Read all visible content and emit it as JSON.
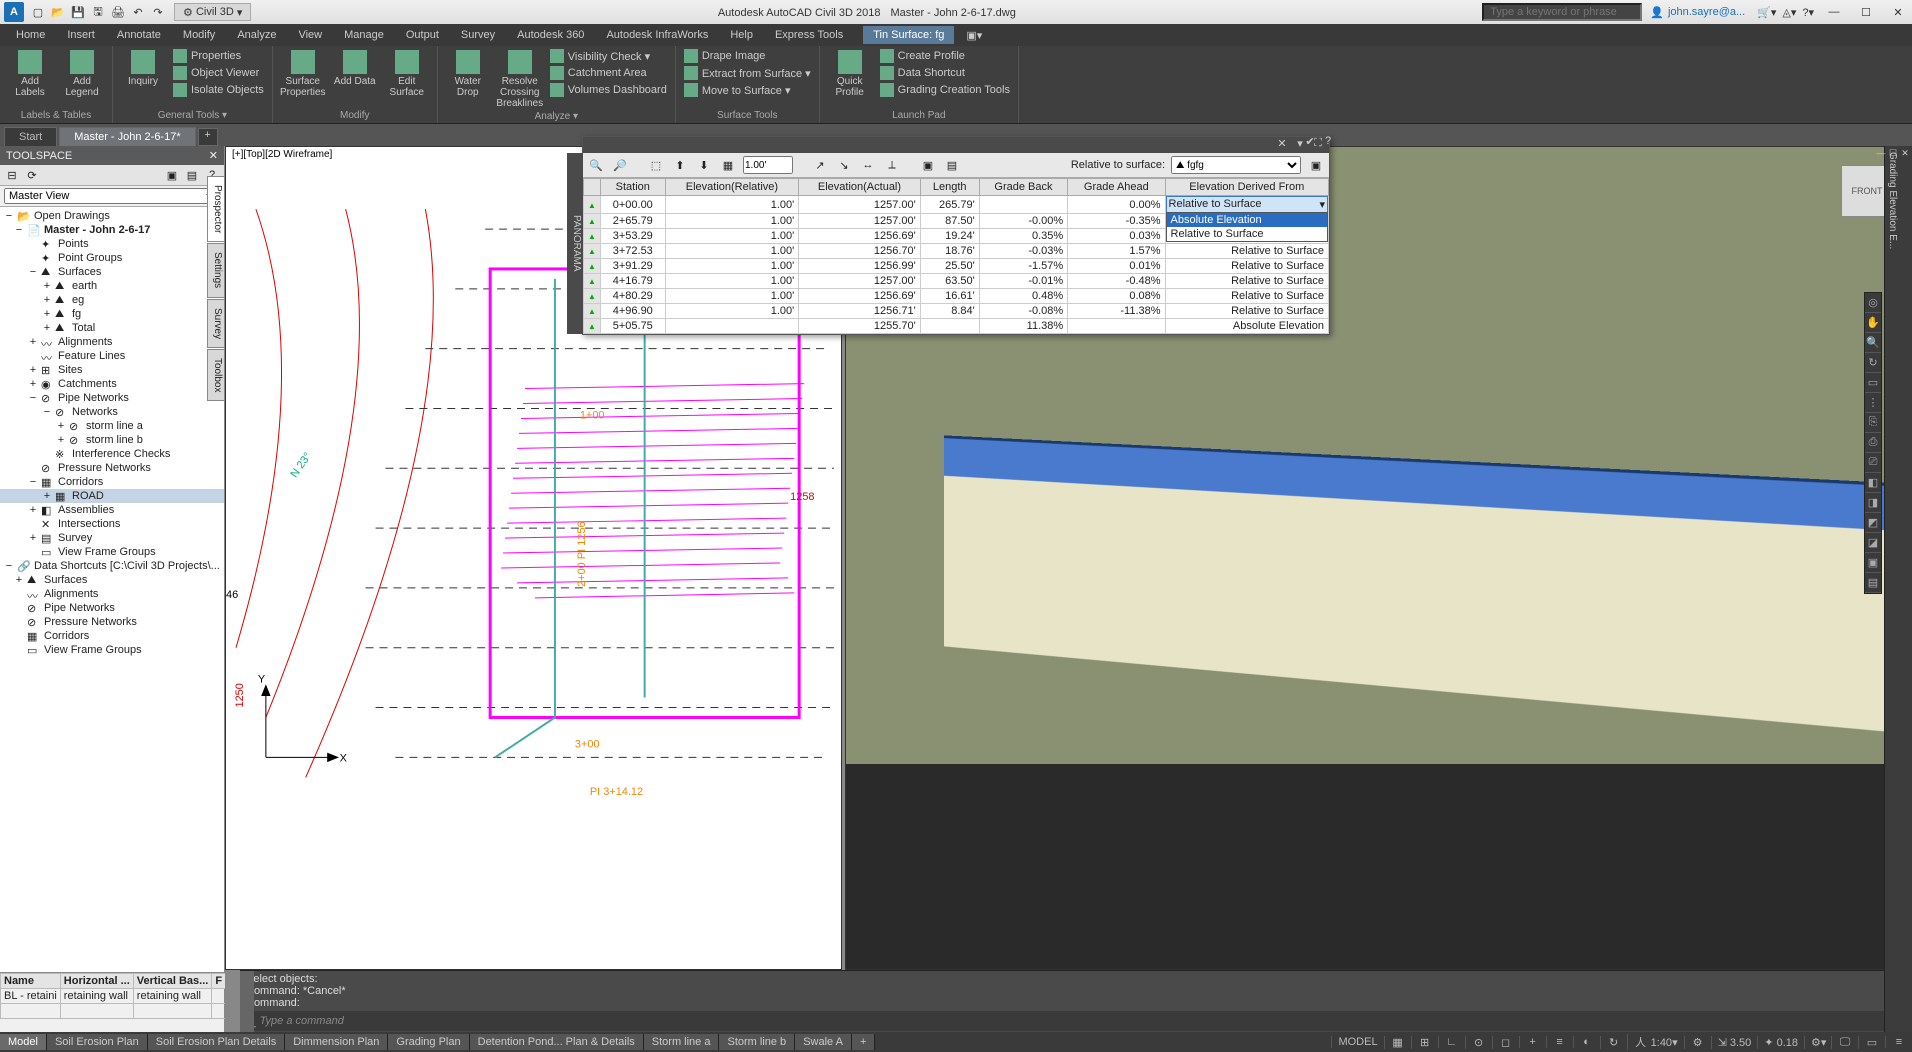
{
  "title": {
    "app": "Autodesk AutoCAD Civil 3D 2018",
    "doc": "Master - John 2-6-17.dwg",
    "workspace": "Civil 3D",
    "search_ph": "Type a keyword or phrase",
    "user": "john.sayre@a..."
  },
  "menu": {
    "tabs": [
      "Home",
      "Insert",
      "Annotate",
      "Modify",
      "Analyze",
      "View",
      "Manage",
      "Output",
      "Survey",
      "Autodesk 360",
      "Autodesk InfraWorks",
      "Help",
      "Express Tools",
      "Tin Surface: fg"
    ],
    "active_ctx": "Tin Surface: fg"
  },
  "ribbon": {
    "panels": [
      {
        "title": "Labels & Tables",
        "big": [
          {
            "lbl": "Add Labels"
          },
          {
            "lbl": "Add Legend"
          }
        ],
        "small": []
      },
      {
        "title": "General Tools ▾",
        "big": [
          {
            "lbl": "Inquiry"
          }
        ],
        "small": [
          "Properties",
          "Object Viewer",
          "Isolate Objects"
        ]
      },
      {
        "title": "Modify",
        "big": [
          {
            "lbl": "Surface Properties"
          },
          {
            "lbl": "Add Data"
          },
          {
            "lbl": "Edit Surface"
          }
        ],
        "small": []
      },
      {
        "title": "Analyze ▾",
        "big": [
          {
            "lbl": "Water Drop"
          },
          {
            "lbl": "Resolve Crossing Breaklines"
          }
        ],
        "small": [
          "Visibility Check ▾",
          "Catchment Area",
          "Volumes Dashboard"
        ]
      },
      {
        "title": "Surface Tools",
        "big": [],
        "small": [
          "Drape Image",
          "Extract from Surface ▾",
          "Move to Surface ▾"
        ]
      },
      {
        "title": "Launch Pad",
        "big": [
          {
            "lbl": "Quick Profile"
          }
        ],
        "small": [
          "Create Profile",
          "Data Shortcut",
          "Grading Creation Tools"
        ]
      }
    ]
  },
  "doctabs": {
    "tabs": [
      {
        "label": "Start"
      },
      {
        "label": "Master - John 2-6-17*",
        "active": true
      }
    ]
  },
  "toolspace": {
    "title": "TOOLSPACE",
    "view": "Master View",
    "tree": [
      {
        "d": 0,
        "tw": "−",
        "ico": "📂",
        "t": "Open Drawings"
      },
      {
        "d": 1,
        "tw": "−",
        "ico": "📄",
        "t": "Master - John 2-6-17",
        "b": true
      },
      {
        "d": 2,
        "tw": "",
        "ico": "✦",
        "t": "Points"
      },
      {
        "d": 2,
        "tw": "",
        "ico": "✦",
        "t": "Point Groups"
      },
      {
        "d": 2,
        "tw": "−",
        "ico": "⛰",
        "t": "Surfaces"
      },
      {
        "d": 3,
        "tw": "+",
        "ico": "⛰",
        "t": "earth"
      },
      {
        "d": 3,
        "tw": "+",
        "ico": "⛰",
        "t": "eg"
      },
      {
        "d": 3,
        "tw": "+",
        "ico": "⛰",
        "t": "fg"
      },
      {
        "d": 3,
        "tw": "+",
        "ico": "⛰",
        "t": "Total"
      },
      {
        "d": 2,
        "tw": "+",
        "ico": "〰",
        "t": "Alignments"
      },
      {
        "d": 2,
        "tw": "",
        "ico": "〰",
        "t": "Feature Lines"
      },
      {
        "d": 2,
        "tw": "+",
        "ico": "⊞",
        "t": "Sites"
      },
      {
        "d": 2,
        "tw": "+",
        "ico": "◉",
        "t": "Catchments"
      },
      {
        "d": 2,
        "tw": "−",
        "ico": "⊘",
        "t": "Pipe Networks"
      },
      {
        "d": 3,
        "tw": "−",
        "ico": "⊘",
        "t": "Networks"
      },
      {
        "d": 4,
        "tw": "+",
        "ico": "⊘",
        "t": "storm line a"
      },
      {
        "d": 4,
        "tw": "+",
        "ico": "⊘",
        "t": "storm line b"
      },
      {
        "d": 3,
        "tw": "",
        "ico": "※",
        "t": "Interference Checks"
      },
      {
        "d": 2,
        "tw": "",
        "ico": "⊘",
        "t": "Pressure Networks"
      },
      {
        "d": 2,
        "tw": "−",
        "ico": "▦",
        "t": "Corridors"
      },
      {
        "d": 3,
        "tw": "+",
        "ico": "▦",
        "t": "ROAD",
        "sel": true
      },
      {
        "d": 2,
        "tw": "+",
        "ico": "◧",
        "t": "Assemblies"
      },
      {
        "d": 2,
        "tw": "",
        "ico": "✕",
        "t": "Intersections"
      },
      {
        "d": 2,
        "tw": "+",
        "ico": "▤",
        "t": "Survey"
      },
      {
        "d": 2,
        "tw": "",
        "ico": "▭",
        "t": "View Frame Groups"
      },
      {
        "d": 0,
        "tw": "−",
        "ico": "🔗",
        "t": "Data Shortcuts [C:\\Civil 3D Projects\\..."
      },
      {
        "d": 1,
        "tw": "+",
        "ico": "⛰",
        "t": "Surfaces"
      },
      {
        "d": 1,
        "tw": "",
        "ico": "〰",
        "t": "Alignments"
      },
      {
        "d": 1,
        "tw": "",
        "ico": "⊘",
        "t": "Pipe Networks"
      },
      {
        "d": 1,
        "tw": "",
        "ico": "⊘",
        "t": "Pressure Networks"
      },
      {
        "d": 1,
        "tw": "",
        "ico": "▦",
        "t": "Corridors"
      },
      {
        "d": 1,
        "tw": "",
        "ico": "▭",
        "t": "View Frame Groups"
      }
    ],
    "side_tabs": [
      "Prospector",
      "Settings",
      "Survey",
      "Toolbox"
    ],
    "grid": {
      "cols": [
        "Name",
        "Horizontal ...",
        "Vertical Bas...",
        "F"
      ],
      "row": [
        "BL - retaini",
        "retaining wall",
        "retaining wall",
        ""
      ]
    }
  },
  "vp": {
    "label": "[+][Top][2D Wireframe]",
    "viewcube": "FRONT"
  },
  "cmd": {
    "hist": [
      "Select objects:",
      "Command: *Cancel*",
      "Command:"
    ],
    "prompt": "Type a command"
  },
  "panorama": {
    "side": "PANORAMA",
    "dist": "1.00'",
    "rel_label": "Relative to surface:",
    "rel_value": "fg",
    "cols": [
      "Station",
      "Elevation(Relative)",
      "Elevation(Actual)",
      "Length",
      "Grade Back",
      "Grade Ahead",
      "Elevation Derived From"
    ],
    "rows": [
      {
        "st": "0+00.00",
        "er": "1.00'",
        "ea": "1257.00'",
        "len": "265.79'",
        "gb": "",
        "ga": "0.00%",
        "ed": "Relative to Surface",
        "dd": true,
        "sel": "Relative to Surface",
        "opts": [
          "Absolute Elevation",
          "Relative to Surface"
        ]
      },
      {
        "st": "2+65.79",
        "er": "1.00'",
        "ea": "1257.00'",
        "len": "87.50'",
        "gb": "-0.00%",
        "ga": "-0.35%",
        "ed": ""
      },
      {
        "st": "3+53.29",
        "er": "1.00'",
        "ea": "1256.69'",
        "len": "19.24'",
        "gb": "0.35%",
        "ga": "0.03%",
        "ed": ""
      },
      {
        "st": "3+72.53",
        "er": "1.00'",
        "ea": "1256.70'",
        "len": "18.76'",
        "gb": "-0.03%",
        "ga": "1.57%",
        "ed": "Relative to Surface"
      },
      {
        "st": "3+91.29",
        "er": "1.00'",
        "ea": "1256.99'",
        "len": "25.50'",
        "gb": "-1.57%",
        "ga": "0.01%",
        "ed": "Relative to Surface"
      },
      {
        "st": "4+16.79",
        "er": "1.00'",
        "ea": "1257.00'",
        "len": "63.50'",
        "gb": "-0.01%",
        "ga": "-0.48%",
        "ed": "Relative to Surface"
      },
      {
        "st": "4+80.29",
        "er": "1.00'",
        "ea": "1256.69'",
        "len": "16.61'",
        "gb": "0.48%",
        "ga": "0.08%",
        "ed": "Relative to Surface"
      },
      {
        "st": "4+96.90",
        "er": "1.00'",
        "ea": "1256.71'",
        "len": "8.84'",
        "gb": "-0.08%",
        "ga": "-11.38%",
        "ed": "Relative to Surface"
      },
      {
        "st": "5+05.75",
        "er": "",
        "ea": "1255.70'",
        "len": "",
        "gb": "11.38%",
        "ga": "",
        "ed": "Absolute Elevation"
      }
    ]
  },
  "right_rail": {
    "title": "Grading Elevation E..."
  },
  "status": {
    "layouts": [
      "Model",
      "Soil Erosion Plan",
      "Soil Erosion Plan Details",
      "Dimmension Plan",
      "Grading Plan",
      "Detention Pond... Plan & Details",
      "Storm line a",
      "Storm line b",
      "Swale A"
    ],
    "model_btn": "MODEL",
    "scale": "1:40",
    "dec": "3.50",
    "zoom": "0.18"
  }
}
